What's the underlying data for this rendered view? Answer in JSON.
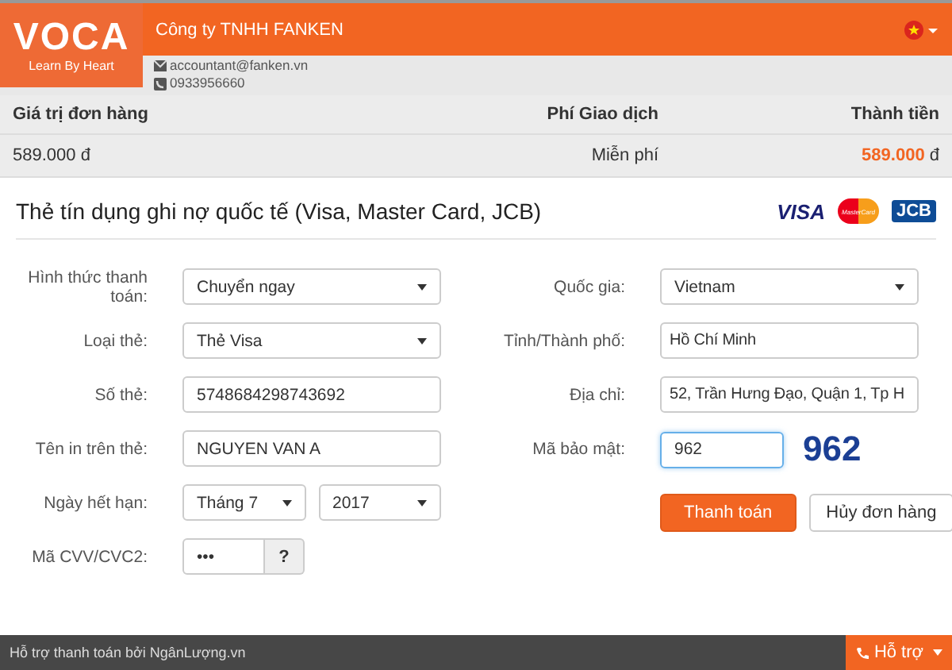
{
  "header": {
    "logo": "VOCA",
    "tagline": "Learn By Heart",
    "company": "Công ty TNHH FANKEN",
    "email": "accountant@fanken.vn",
    "phone": "0933956660"
  },
  "summary": {
    "columns": [
      "Giá trị đơn hàng",
      "Phí Giao dịch",
      "Thành tiền"
    ],
    "values": [
      {
        "kind": "plain",
        "text": "589.000 đ"
      },
      {
        "kind": "plain",
        "text": "Miễn phí"
      },
      {
        "kind": "total",
        "amount": "589.000",
        "unit": "đ"
      }
    ]
  },
  "form": {
    "title": "Thẻ tín dụng ghi nợ quốc tế (Visa, Master Card, JCB)",
    "card_logos": [
      {
        "kind": "visa",
        "text": "VISA"
      },
      {
        "kind": "mastercard",
        "text": "MasterCard"
      },
      {
        "kind": "jcb",
        "text": "JCB"
      }
    ],
    "left_fields": [
      {
        "kind": "select",
        "label": "Hình thức thanh toán:",
        "value": "Chuyển ngay"
      },
      {
        "kind": "select",
        "label": "Loại thẻ:",
        "value": "Thẻ Visa"
      },
      {
        "kind": "input",
        "label": "Số thẻ:",
        "value": "5748684298743692"
      },
      {
        "kind": "input",
        "label": "Tên in trên thẻ:",
        "value": "NGUYEN VAN A"
      },
      {
        "kind": "date",
        "label": "Ngày hết hạn:",
        "month": "Tháng 7",
        "year": "2017"
      },
      {
        "kind": "cvv",
        "label": "Mã CVV/CVC2:",
        "value": "•••",
        "help": "?"
      }
    ],
    "right_fields": [
      {
        "kind": "select",
        "label": "Quốc gia:",
        "value": "Vietnam",
        "focused": false
      },
      {
        "kind": "input",
        "label": "Tỉnh/Thành phố:",
        "value": "Hồ Chí Minh",
        "focused": false
      },
      {
        "kind": "input",
        "label": "Địa chỉ:",
        "value": "52, Trần Hưng Đạo, Quận 1, Tp H",
        "focused": false
      },
      {
        "kind": "captcha",
        "label": "Mã bảo mật:",
        "value": "962",
        "code": "962",
        "focused": true
      }
    ],
    "buttons": [
      {
        "kind": "primary",
        "label": "Thanh toán"
      },
      {
        "kind": "secondary",
        "label": "Hủy đơn hàng"
      }
    ]
  },
  "footer": {
    "text": "Hỗ trợ thanh toán bởi NgânLượng.vn",
    "support": "Hỗ trợ"
  }
}
